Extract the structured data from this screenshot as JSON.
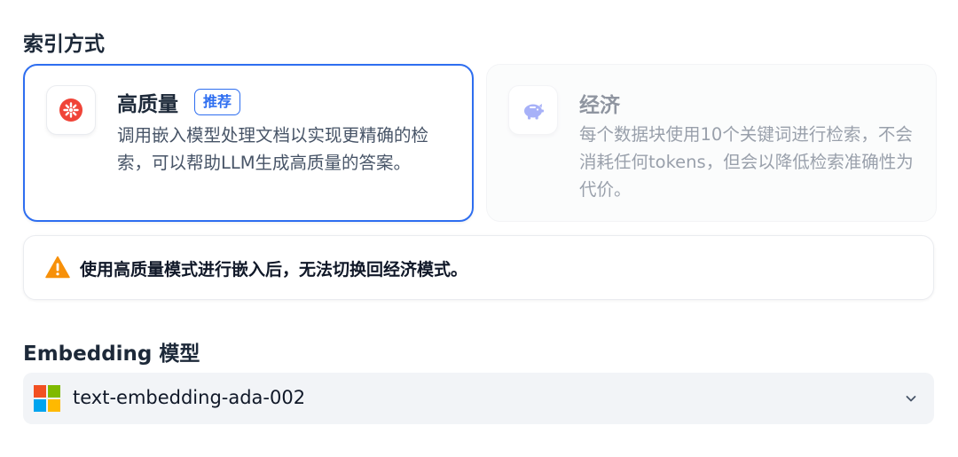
{
  "indexing": {
    "section_title": "索引方式",
    "high_quality": {
      "title": "高质量",
      "badge": "推荐",
      "description": "调用嵌入模型处理文档以实现更精确的检索，可以帮助LLM生成高质量的答案。",
      "icon": "sparkle-star-icon",
      "icon_color": "#f04438",
      "selected": true
    },
    "economy": {
      "title": "经济",
      "description": "每个数据块使用10个关键词进行检索，不会消耗任何tokens，但会以降低检索准确性为代价。",
      "icon": "piggy-bank-icon",
      "icon_color": "#6172f3",
      "selected": false
    }
  },
  "warning": {
    "text": "使用高质量模式进行嵌入后，无法切换回经济模式。",
    "icon": "warning-triangle-icon",
    "color": "#f79009"
  },
  "embedding": {
    "section_title": "Embedding 模型",
    "selected_model": "text-embedding-ada-002",
    "provider_icon": "microsoft-logo-icon",
    "dropdown_icon": "chevron-down-icon"
  },
  "colors": {
    "accent": "#2e6ef0",
    "ms_red": "#f25022",
    "ms_green": "#7fba00",
    "ms_blue": "#00a4ef",
    "ms_yellow": "#ffb900"
  }
}
